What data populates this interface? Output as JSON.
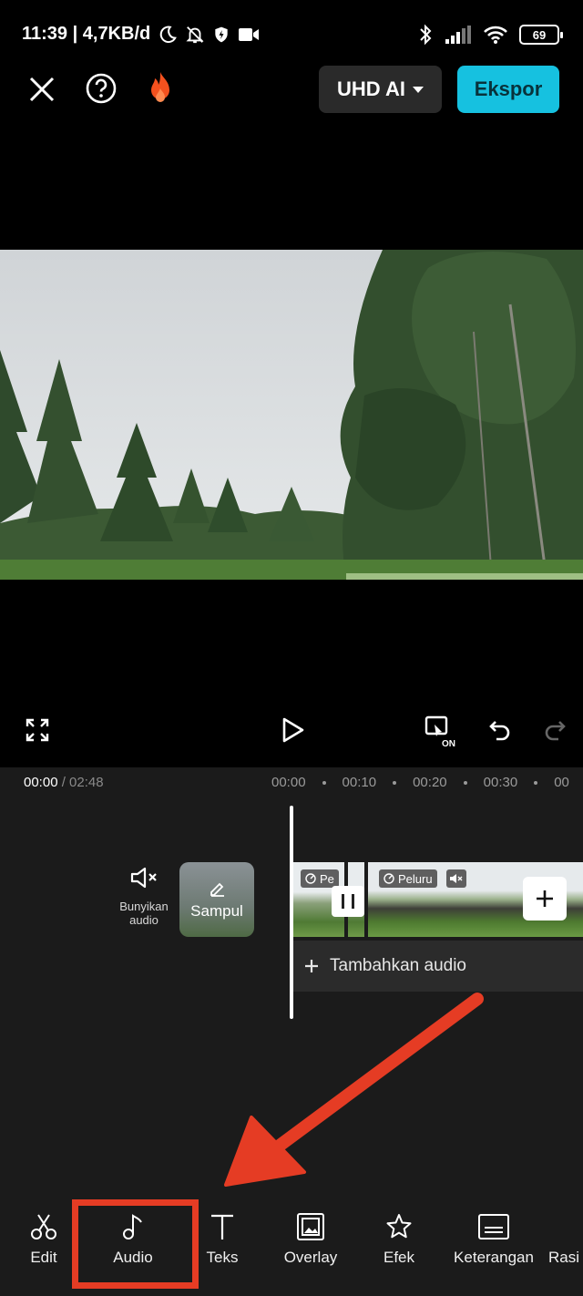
{
  "status_bar": {
    "time_speed": "11:39 | 4,7KB/d",
    "battery": "69"
  },
  "toolbar": {
    "quality_label": "UHD AI",
    "export_label": "Ekspor"
  },
  "timeline": {
    "current_time": "00:00",
    "total_time": "/ 02:48",
    "ruler_marks": [
      "00:00",
      "00:10",
      "00:20",
      "00:30",
      "00"
    ],
    "mute_label": "Bunyikan audio",
    "cover_label": "Sampul",
    "clip_tags": [
      "Pe",
      "Peluru"
    ],
    "add_audio_label": "Tambahkan audio"
  },
  "bottom_tools": [
    {
      "label": "Edit",
      "icon": "scissors-icon"
    },
    {
      "label": "Audio",
      "icon": "music-note-icon"
    },
    {
      "label": "Teks",
      "icon": "text-icon"
    },
    {
      "label": "Overlay",
      "icon": "overlay-icon"
    },
    {
      "label": "Efek",
      "icon": "star-effect-icon"
    },
    {
      "label": "Keterangan",
      "icon": "caption-icon"
    },
    {
      "label": "Rasi",
      "icon": "ratio-icon"
    }
  ],
  "colors": {
    "accent": "#16c1e0",
    "highlight": "#e53c24",
    "background": "#1b1b1b"
  }
}
